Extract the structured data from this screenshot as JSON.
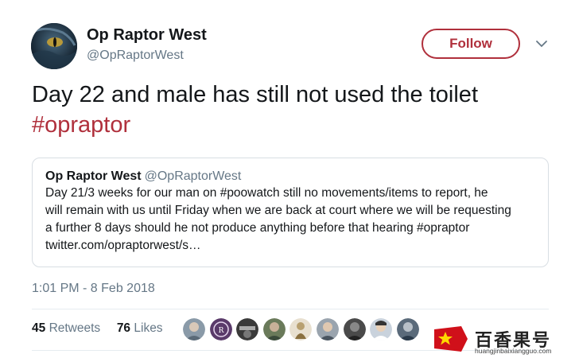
{
  "author": {
    "name": "Op Raptor West",
    "handle": "@OpRaptorWest",
    "avatar_icon": "raptor-eye-avatar"
  },
  "follow_button": {
    "label": "Follow",
    "color": "#b0303c"
  },
  "menu_icon": "chevron-down-icon",
  "tweet": {
    "text": "Day 22 and male has still not used the toilet",
    "hashtag": "#opraptor"
  },
  "quoted_tweet": {
    "name": "Op Raptor West",
    "handle": "@OpRaptorWest",
    "lines": [
      "Day 21/3 weeks for our man on #poowatch still no movements/items to report, he",
      "will remain with us until Friday when we are back at court where we will be requesting",
      "a further 8 days should he not produce anything before that hearing #opraptor",
      "twitter.com/opraptorwest/s…"
    ]
  },
  "timestamp": "1:01 PM - 8 Feb 2018",
  "stats": {
    "retweets_count": "45",
    "retweets_label": "Retweets",
    "likes_count": "76",
    "likes_label": "Likes"
  },
  "likers": [
    {
      "name": "liker-avatar-1",
      "color": "#8a9aa8"
    },
    {
      "name": "liker-avatar-2",
      "color": "#5a3a6a"
    },
    {
      "name": "liker-avatar-3",
      "color": "#3a3a3a"
    },
    {
      "name": "liker-avatar-4",
      "color": "#6a7a5a"
    },
    {
      "name": "liker-avatar-5",
      "color": "#b8a070"
    },
    {
      "name": "liker-avatar-6",
      "color": "#9aa4ae"
    },
    {
      "name": "liker-avatar-7",
      "color": "#4a4a4a"
    },
    {
      "name": "liker-avatar-8",
      "color": "#c9d2dc"
    },
    {
      "name": "liker-avatar-9",
      "color": "#5a6a7a"
    }
  ],
  "watermark": {
    "text": "百香果号",
    "url": "huangjinbaixiangguo.com",
    "color": "#d0101a"
  }
}
